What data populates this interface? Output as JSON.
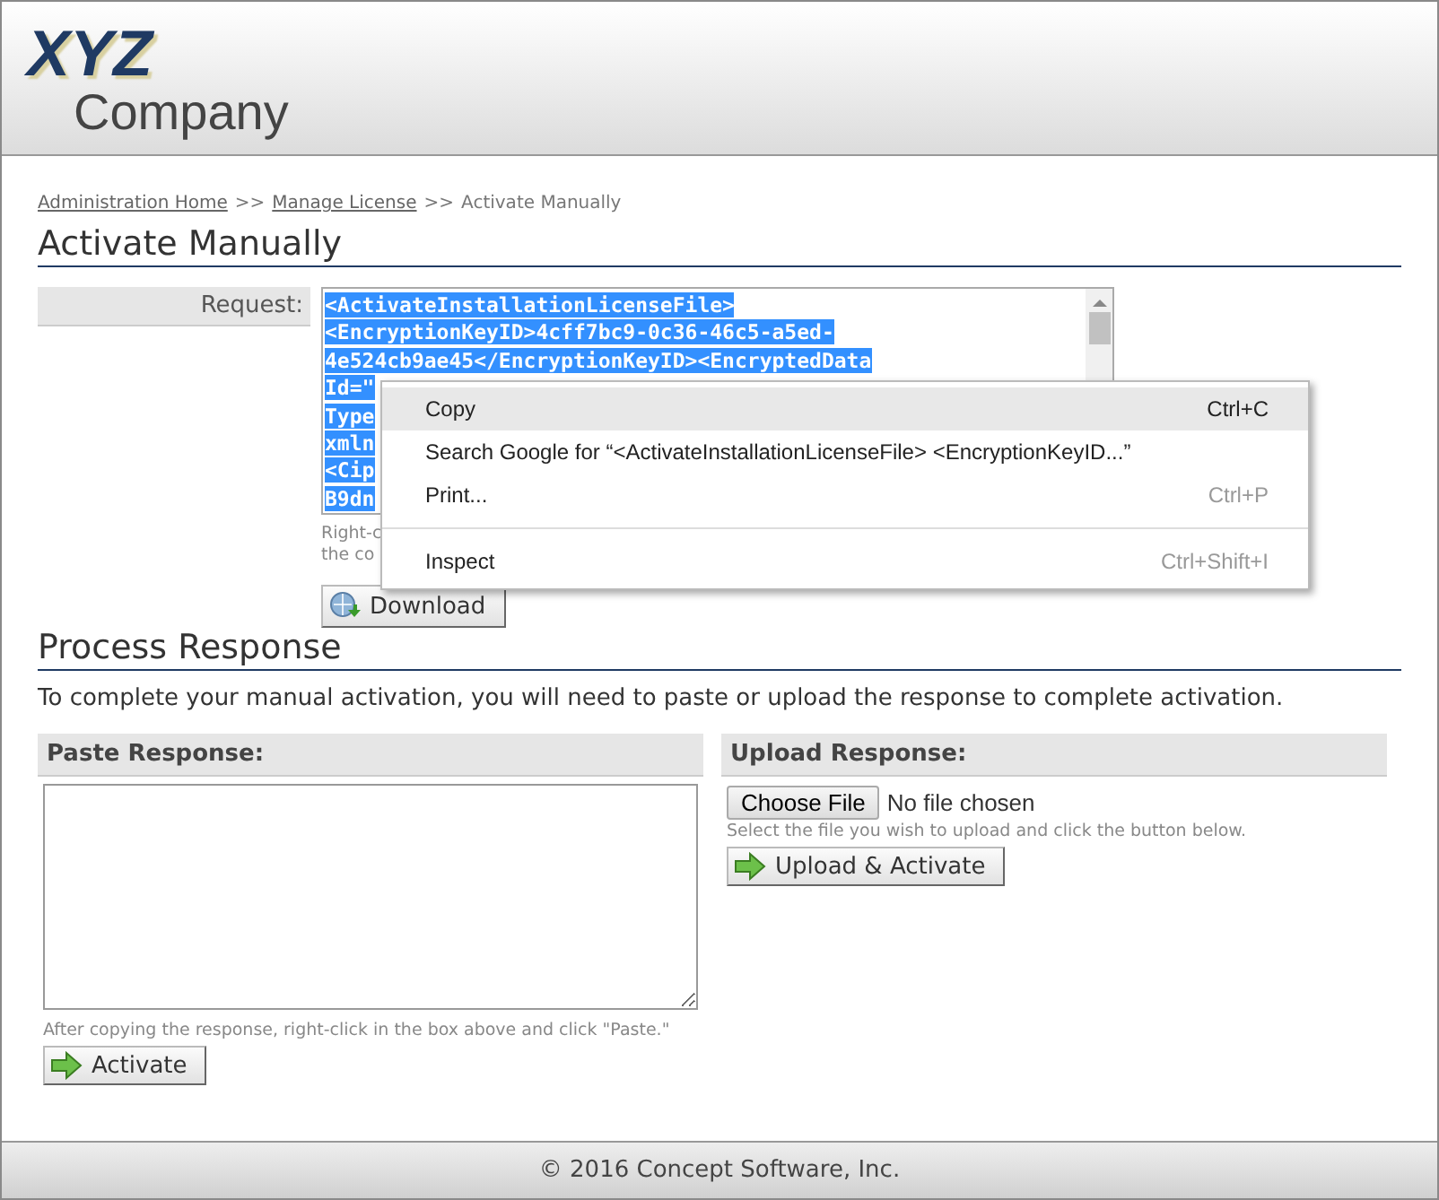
{
  "header": {
    "logo_top": "XYZ",
    "logo_bottom": "Company"
  },
  "breadcrumb": [
    {
      "label": "Administration Home",
      "link": true
    },
    {
      "label": ">>",
      "link": false
    },
    {
      "label": "Manage License",
      "link": true
    },
    {
      "label": ">>",
      "link": false
    },
    {
      "label": "Activate Manually",
      "link": false
    }
  ],
  "activate_manually": {
    "title": "Activate Manually",
    "request_label": "Request:",
    "request_lines": [
      {
        "text": "<ActivateInstallationLicenseFile>",
        "selected": true
      },
      {
        "text": "<EncryptionKeyID>4cff7bc9-0c36-46c5-a5ed-",
        "selected": true
      },
      {
        "text": "4e524cb9ae45</EncryptionKeyID><EncryptedData",
        "selected": true
      },
      {
        "text": "Id=\"",
        "selected": true
      },
      {
        "text": "Type",
        "selected": true
      },
      {
        "text": "xmln",
        "selected": true
      },
      {
        "text": "<Cip",
        "selected": true
      },
      {
        "text": "B9dn",
        "selected": true
      }
    ],
    "hint_lines": [
      "Right-c",
      "the co"
    ],
    "download_button": "Download"
  },
  "context_menu": [
    {
      "kind": "item",
      "label": "Copy",
      "shortcut": "Ctrl+C",
      "selected": true
    },
    {
      "kind": "item",
      "label": "Search Google for “<ActivateInstallationLicenseFile> <EncryptionKeyID...”",
      "selected": false
    },
    {
      "kind": "item",
      "label": "Print...",
      "shortcut": "Ctrl+P",
      "selected": false
    },
    {
      "kind": "separator"
    },
    {
      "kind": "item",
      "label": "Inspect",
      "shortcut": "Ctrl+Shift+I",
      "selected": false
    }
  ],
  "process_response": {
    "title": "Process Response",
    "description": "To complete your manual activation, you will need to paste or upload the response to complete activation.",
    "paste": {
      "heading": "Paste Response:",
      "hint": "After copying the response, right-click in the box above and click \"Paste.\"",
      "button": "Activate"
    },
    "upload": {
      "heading": "Upload Response:",
      "choose_button": "Choose File",
      "file_status": "No file chosen",
      "hint": "Select the file you wish to upload and click the button below.",
      "button": "Upload & Activate"
    }
  },
  "footer": "© 2016 Concept Software, Inc."
}
